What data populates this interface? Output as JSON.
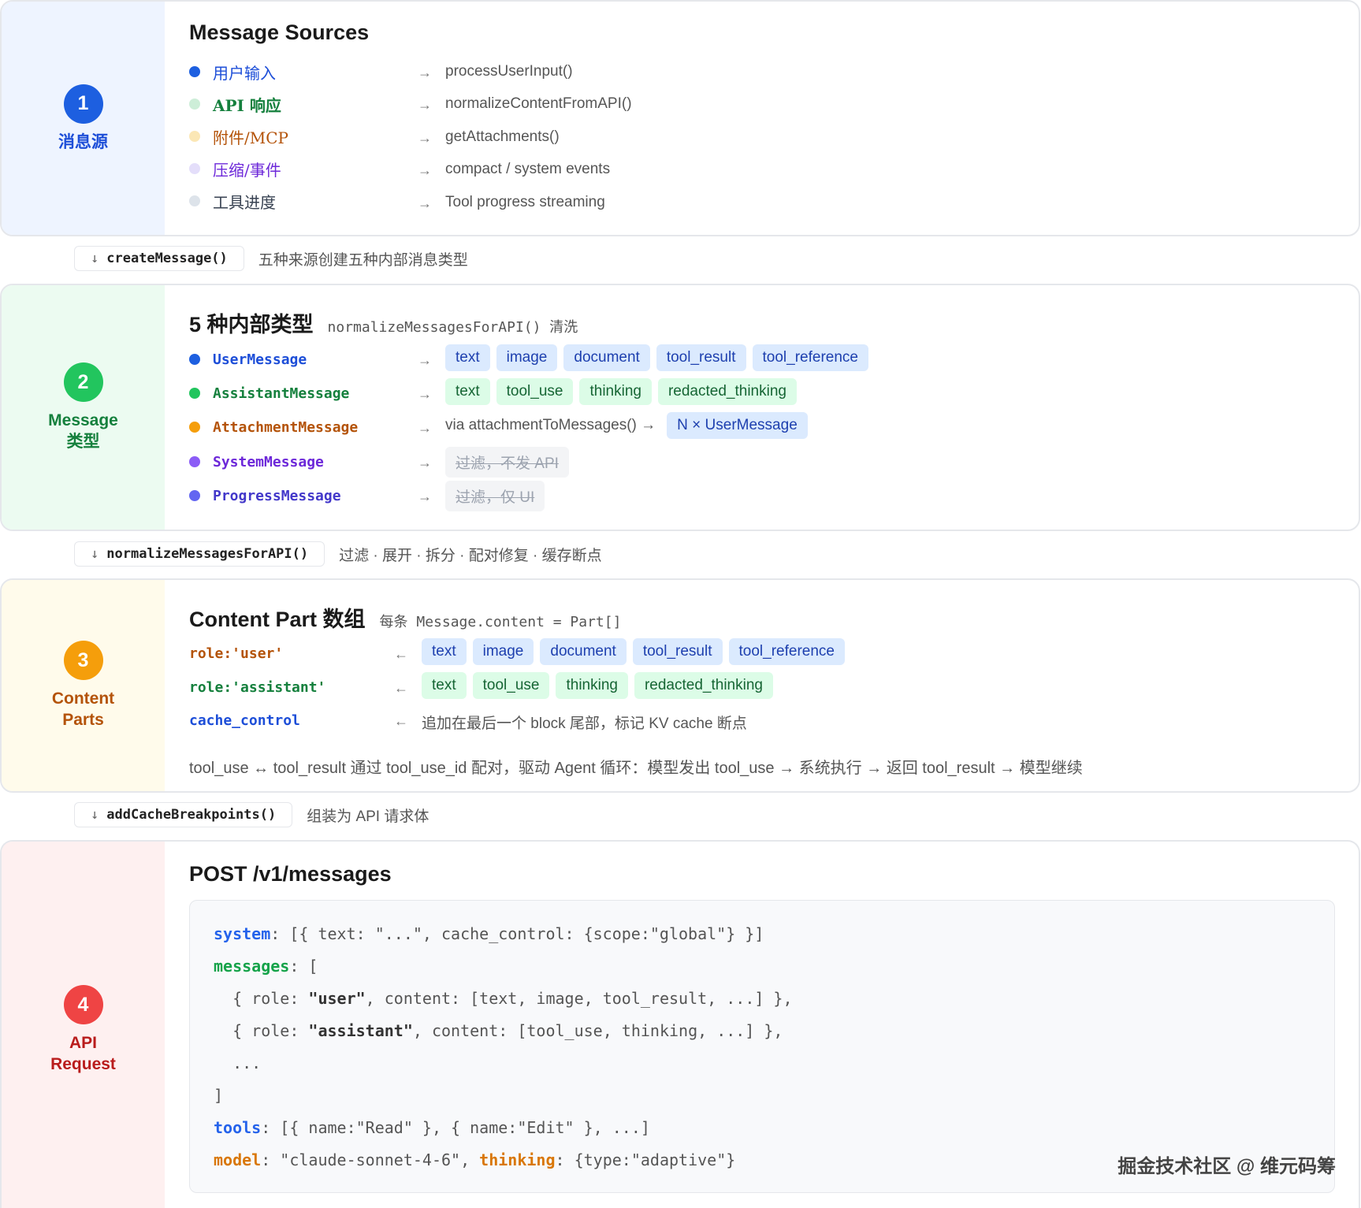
{
  "sections": [
    {
      "number": "1",
      "label": "消息源",
      "title": "Message Sources",
      "colors": {
        "side_bg": "#eef4ff",
        "badge": "#1d5fe0",
        "label": "#1d4ed8"
      },
      "rows": [
        {
          "dot": "#1d5fe0",
          "text": "用户输入",
          "color": "#1d4ed8",
          "target": "processUserInput()"
        },
        {
          "dot": "#cdeed8",
          "text": "API 响应",
          "color": "#15803d",
          "target": "normalizeContentFromAPI()"
        },
        {
          "dot": "#fbe7b5",
          "text": "附件/MCP",
          "color": "#b45309",
          "target": "getAttachments()"
        },
        {
          "dot": "#e4defa",
          "text": "压缩/事件",
          "color": "#6d28d9",
          "target": "compact / system events"
        },
        {
          "dot": "#dde3ea",
          "text": "工具进度",
          "color": "#374151",
          "target": "Tool progress streaming"
        }
      ]
    },
    {
      "number": "2",
      "label": "Message\n类型",
      "title": "5 种内部类型",
      "title_note": "normalizeMessagesForAPI() 清洗",
      "colors": {
        "side_bg": "#ecfbf1",
        "badge": "#22c55e",
        "label": "#15803d"
      },
      "rows": [
        {
          "dot": "#1d5fe0",
          "text": "UserMessage",
          "color": "#1d4ed8",
          "chips": [
            {
              "label": "text",
              "style": "blue"
            },
            {
              "label": "image",
              "style": "blue"
            },
            {
              "label": "document",
              "style": "blue"
            },
            {
              "label": "tool_result",
              "style": "blue"
            },
            {
              "label": "tool_reference",
              "style": "blue"
            }
          ]
        },
        {
          "dot": "#22c55e",
          "text": "AssistantMessage",
          "color": "#15803d",
          "chips": [
            {
              "label": "text",
              "style": "green"
            },
            {
              "label": "tool_use",
              "style": "green"
            },
            {
              "label": "thinking",
              "style": "green"
            },
            {
              "label": "redacted_thinking",
              "style": "green"
            }
          ]
        },
        {
          "dot": "#f59e0b",
          "text": "AttachmentMessage",
          "color": "#b45309",
          "prefix": "via attachmentToMessages() →",
          "chips": [
            {
              "label": "N × UserMessage",
              "style": "blue"
            }
          ]
        },
        {
          "dot": "#8b5cf6",
          "text": "SystemMessage",
          "color": "#6d28d9",
          "chips": [
            {
              "label": "过滤，不发 API",
              "style": "grey"
            }
          ]
        },
        {
          "dot": "#6366f1",
          "text": "ProgressMessage",
          "color": "#4338ca",
          "chips": [
            {
              "label": "过滤，仅 UI",
              "style": "grey"
            }
          ]
        }
      ]
    },
    {
      "number": "3",
      "label": "Content\nParts",
      "title": "Content Part 数组",
      "title_note": "每条 Message.content = Part[]",
      "colors": {
        "side_bg": "#fffbeb",
        "badge": "#f59e0b",
        "label": "#b45309"
      },
      "rows": [
        {
          "text": "role:'user'",
          "color": "#b45309",
          "chips": [
            {
              "label": "text",
              "style": "blue"
            },
            {
              "label": "image",
              "style": "blue"
            },
            {
              "label": "document",
              "style": "blue"
            },
            {
              "label": "tool_result",
              "style": "blue"
            },
            {
              "label": "tool_reference",
              "style": "blue"
            }
          ]
        },
        {
          "text": "role:'assistant'",
          "color": "#15803d",
          "chips": [
            {
              "label": "text",
              "style": "green"
            },
            {
              "label": "tool_use",
              "style": "green"
            },
            {
              "label": "thinking",
              "style": "green"
            },
            {
              "label": "redacted_thinking",
              "style": "green"
            }
          ]
        },
        {
          "text": "cache_control",
          "color": "#1d4ed8",
          "note": "追加在最后一个 block 尾部，标记 KV cache 断点"
        }
      ],
      "flow_note": "tool_use ↔ tool_result 通过 tool_use_id 配对，驱动 Agent 循环：模型发出 tool_use → 系统执行 → 返回 tool_result → 模型继续"
    },
    {
      "number": "4",
      "label": "API\nRequest",
      "title": "POST /v1/messages",
      "colors": {
        "side_bg": "#fef0f0",
        "badge": "#ef4444",
        "label": "#b91c1c"
      }
    }
  ],
  "connectors": [
    {
      "fn": "createMessage()",
      "desc": "五种来源创建五种内部消息类型"
    },
    {
      "fn": "normalizeMessagesForAPI()",
      "desc": "过滤 · 展开 · 拆分 · 配对修复 · 缓存断点"
    },
    {
      "fn": "addCacheBreakpoints()",
      "desc": "组装为 API 请求体"
    }
  ],
  "arrows": {
    "right": "→",
    "left": "←",
    "down": "↓"
  },
  "code": {
    "l1": {
      "key": "system",
      "rest": ": [{ text: \"...\", cache_control: {scope:\"global\"} }]"
    },
    "l2": {
      "key": "messages",
      "rest": ": ["
    },
    "l3": {
      "pre": "  { role: ",
      "str": "\"user\"",
      "post": ", content: [text, image, tool_result, ...] },"
    },
    "l4": {
      "pre": "  { role: ",
      "str": "\"assistant\"",
      "post": ", content: [tool_use, thinking, ...] },"
    },
    "l5": "  ...",
    "l6": "]",
    "l7": {
      "key": "tools",
      "rest": ": [{ name:\"Read\" }, { name:\"Edit\" }, ...]"
    },
    "l8": {
      "key": "model",
      "mid": ": \"claude-sonnet-4-6\", ",
      "key2": "thinking",
      "rest": ": {type:\"adaptive\"}"
    }
  },
  "watermark": "掘金技术社区 @ 维元码筹"
}
